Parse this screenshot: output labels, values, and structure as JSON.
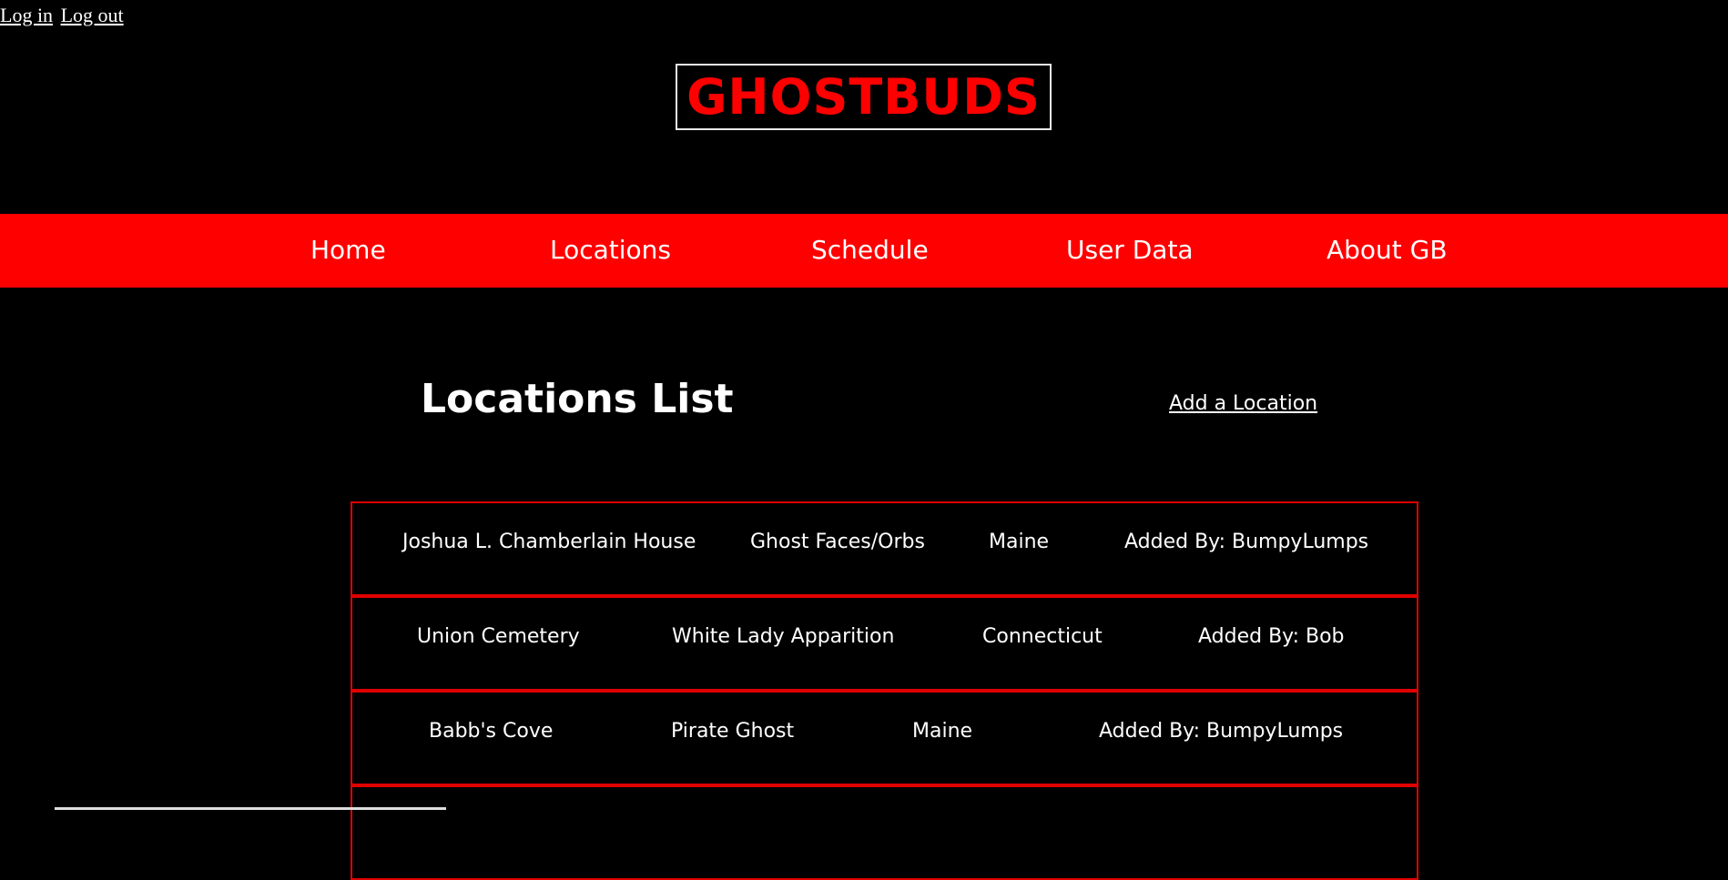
{
  "auth": {
    "login_label": "Log in",
    "logout_label": "Log out"
  },
  "brand": {
    "logo_text": "GHOSTBUDS"
  },
  "nav": {
    "items": [
      {
        "label": "Home"
      },
      {
        "label": "Locations"
      },
      {
        "label": "Schedule"
      },
      {
        "label": "User Data"
      },
      {
        "label": "About GB"
      }
    ]
  },
  "main": {
    "title": "Locations List",
    "add_location_label": "Add a Location"
  },
  "locations": [
    {
      "name": "Joshua L. Chamberlain House",
      "type": "Ghost Faces/Orbs",
      "state": "Maine",
      "added_by": "Added By: BumpyLumps"
    },
    {
      "name": "Union Cemetery",
      "type": "White Lady Apparition",
      "state": "Connecticut",
      "added_by": "Added By: Bob"
    },
    {
      "name": "Babb's Cove",
      "type": "Pirate Ghost",
      "state": "Maine",
      "added_by": "Added By: BumpyLumps"
    }
  ],
  "colors": {
    "background": "#000000",
    "accent_red": "#ff0000",
    "text": "#ffffff"
  }
}
